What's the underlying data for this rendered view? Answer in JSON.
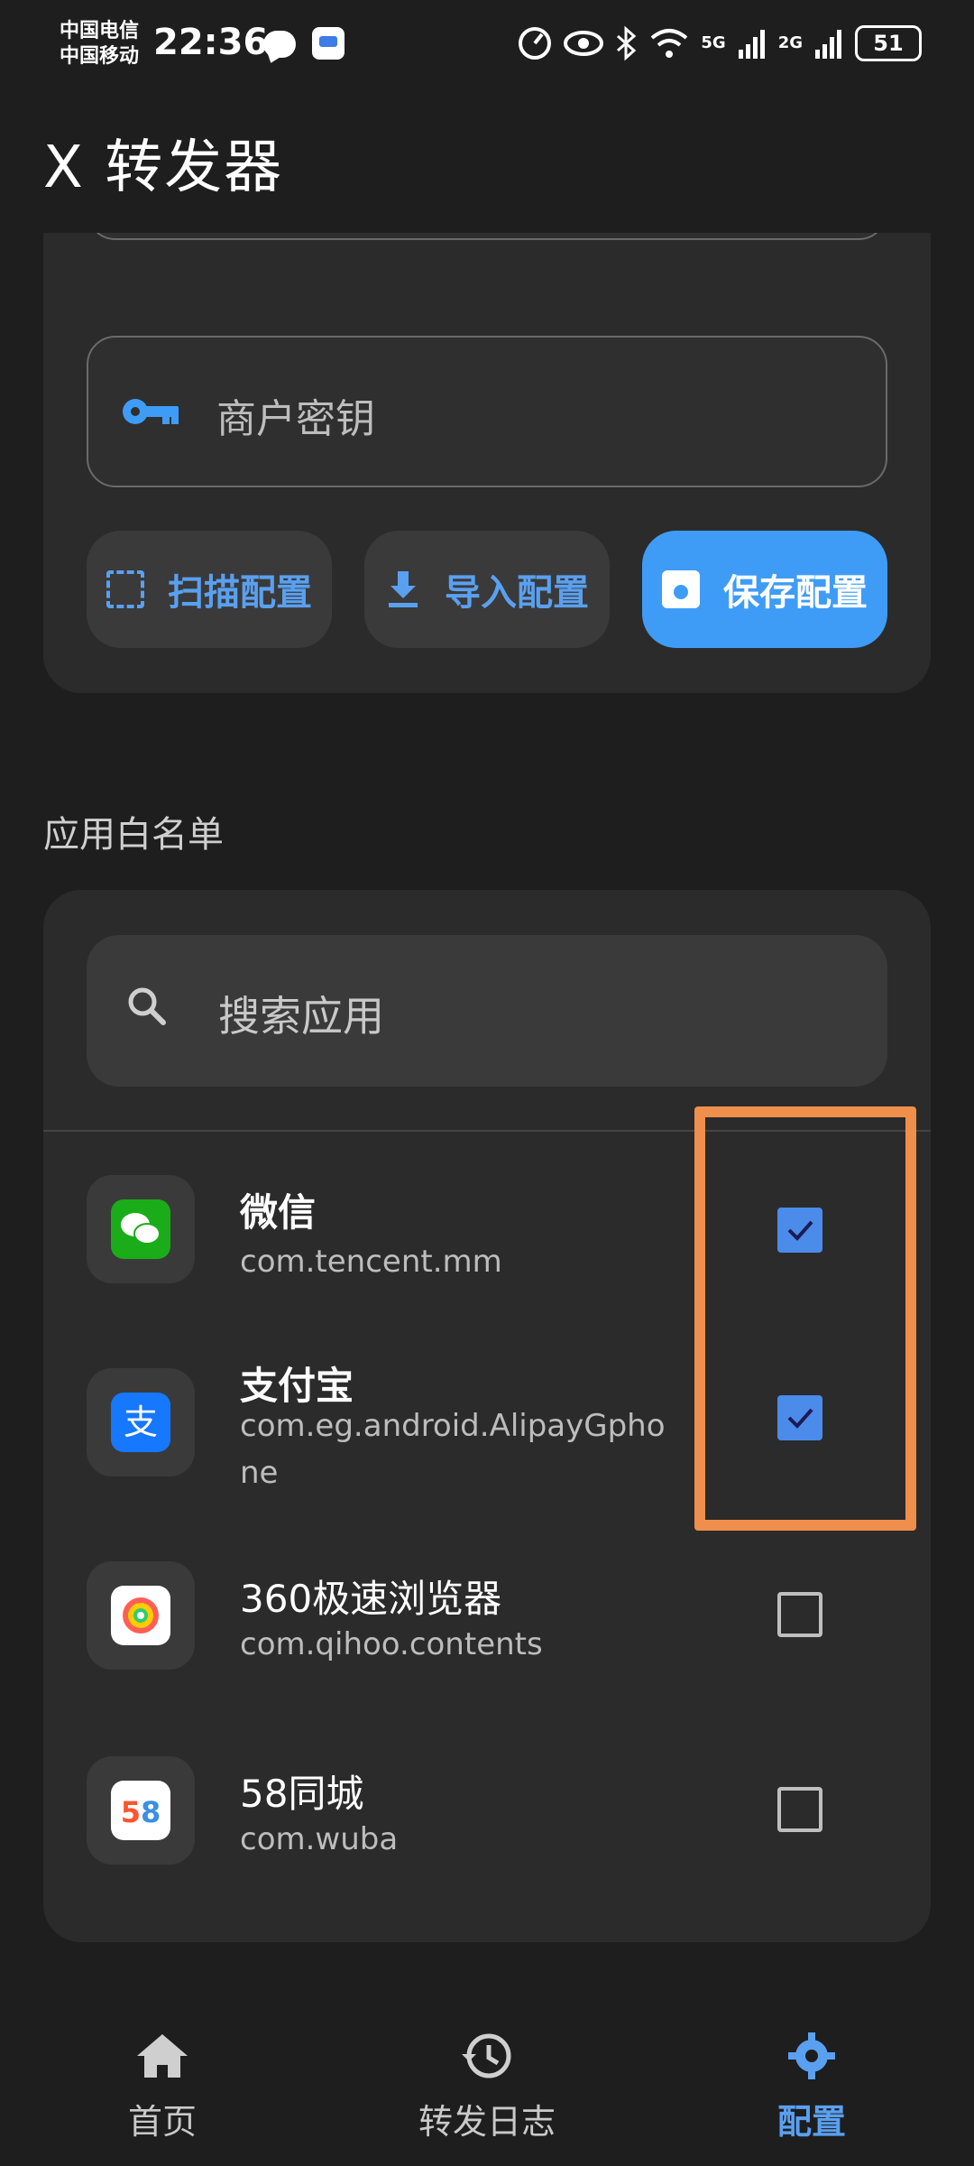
{
  "status_bar": {
    "carrier_1": "中国电信",
    "carrier_2": "中国移动",
    "time": "22:36",
    "signal_5g": "5G",
    "signal_2g": "2G",
    "battery": "51",
    "icons": [
      "chat-bubble-icon",
      "app-notification-icon",
      "speed-icon",
      "eye-icon",
      "bluetooth-icon",
      "wifi-icon",
      "signal-icon",
      "battery-icon"
    ]
  },
  "appbar": {
    "title": "X 转发器"
  },
  "config_card": {
    "merchant_key_label": "商户密钥",
    "buttons": {
      "scan": "扫描配置",
      "import": "导入配置",
      "save": "保存配置"
    }
  },
  "whitelist": {
    "section_title": "应用白名单",
    "search_placeholder": "搜索应用",
    "apps": [
      {
        "name": "微信",
        "package": "com.tencent.mm",
        "checked": true,
        "icon": "wechat-icon"
      },
      {
        "name": "支付宝",
        "package": "com.eg.android.AlipayGphone",
        "package_line1": "com.eg.android.AlipayGpho",
        "package_line2": "ne",
        "checked": true,
        "icon": "alipay-icon"
      },
      {
        "name": "360极速浏览器",
        "package": "com.qihoo.contents",
        "checked": false,
        "icon": "360-browser-icon"
      },
      {
        "name": "58同城",
        "package": "com.wuba",
        "checked": false,
        "icon": "58-tongcheng-icon"
      }
    ]
  },
  "bottom_nav": {
    "home": "首页",
    "logs": "转发日志",
    "config": "配置",
    "active": "config"
  },
  "colors": {
    "accent": "#3f9cf6",
    "highlight": "#ef8f4b",
    "background": "#1e1e1e",
    "card": "#2b2b2b"
  }
}
